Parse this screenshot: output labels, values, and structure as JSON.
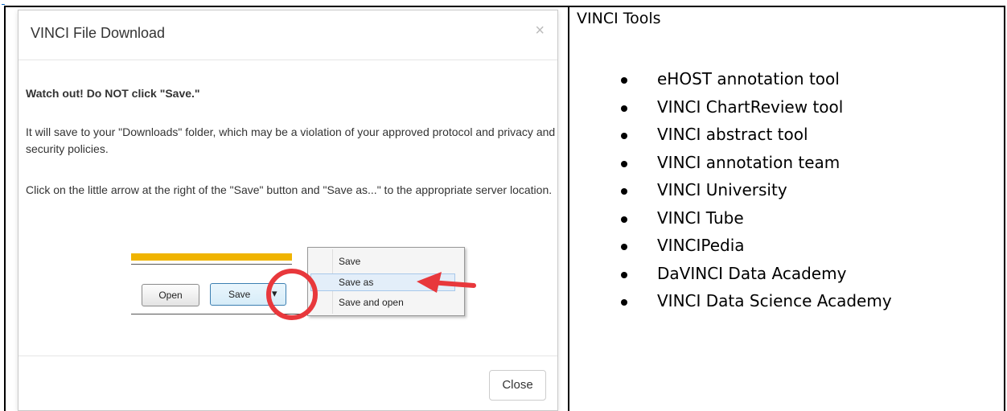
{
  "dialog": {
    "title": "VINCI File Download",
    "close_x": "×",
    "warning": "Watch out! Do NOT click \"Save.\"",
    "paragraph1": "It will save to your \"Downloads\" folder, which may be a violation of your approved protocol and privacy and security policies.",
    "paragraph2": "Click on the little arrow at the right of the \"Save\" button and \"Save as...\" to the appropriate server location.",
    "close_button": "Close",
    "screenshot": {
      "open_button": "Open",
      "save_button": "Save",
      "dropdown_arrow": "▾",
      "menu_items": [
        "Save",
        "Save as",
        "Save and open"
      ],
      "highlight_color": "#e8383c"
    }
  },
  "tools": {
    "title": "VINCI Tools",
    "items": [
      "eHOST annotation tool",
      "VINCI ChartReview tool",
      "VINCI abstract tool",
      "VINCI annotation team",
      "VINCI University",
      "VINCI Tube",
      "VINCIPedia",
      "DaVINCI Data Academy",
      "VINCI Data Science Academy"
    ]
  }
}
